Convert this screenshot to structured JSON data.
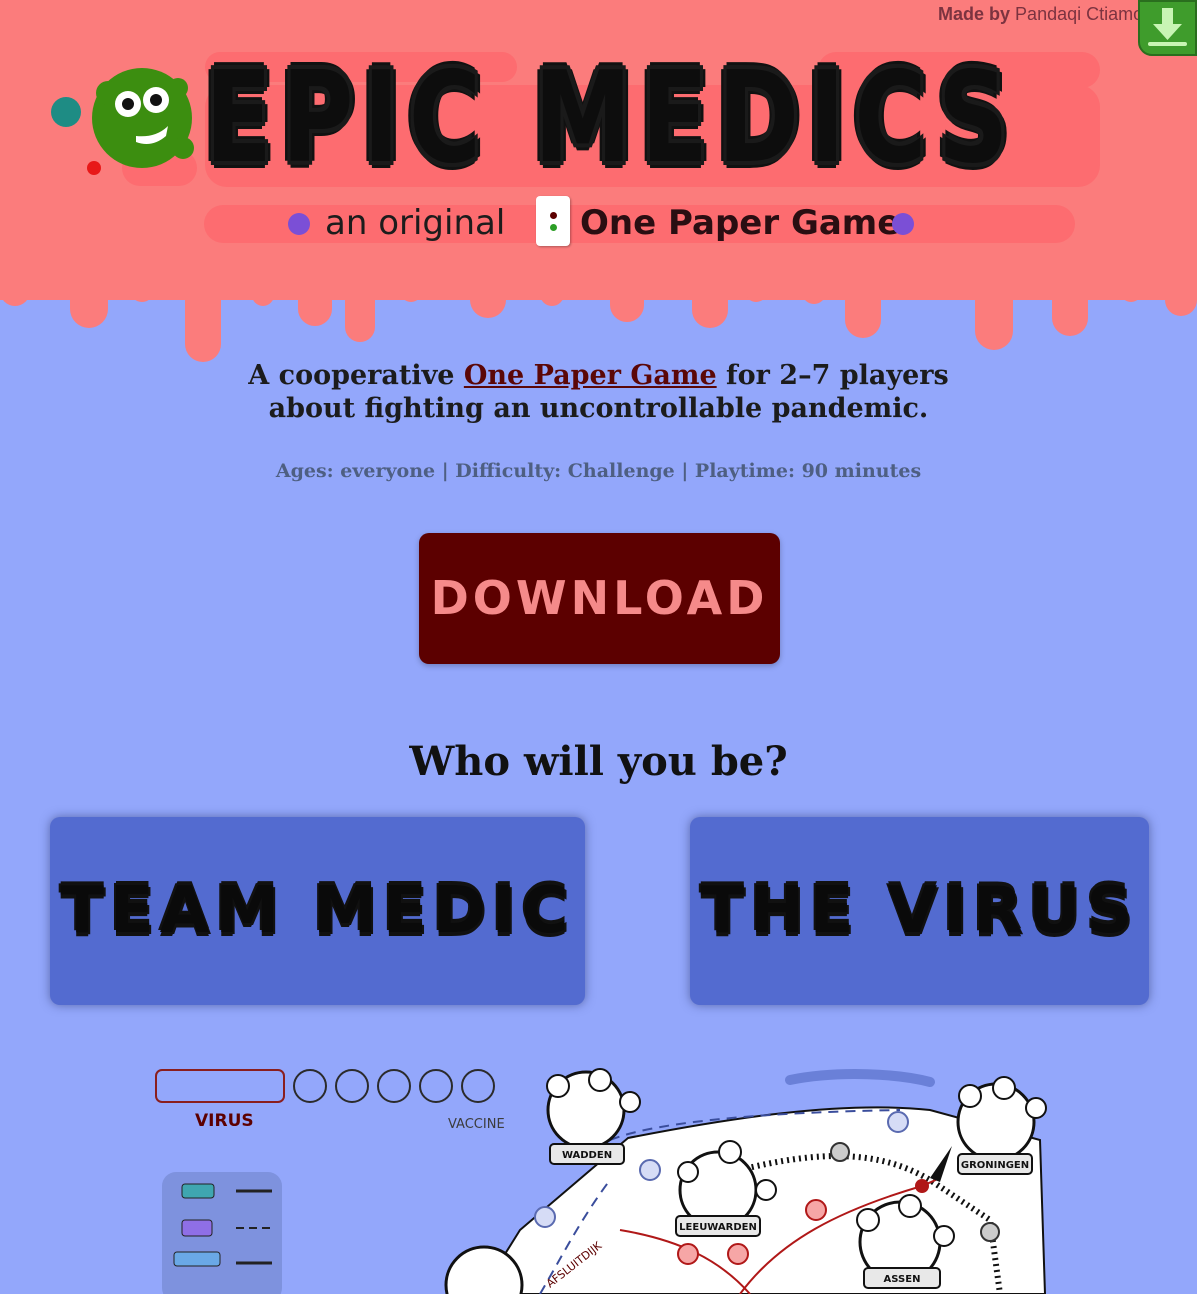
{
  "credit": {
    "made_by": "Made by",
    "studio": "Pandaqi Ctiamo P"
  },
  "header": {
    "title": "EPIC MEDICS",
    "subtitle_prefix": "an original",
    "subtitle_brand": "One Paper Game"
  },
  "intro": {
    "line1_before": "A cooperative ",
    "line1_link": "One Paper Game",
    "line1_after": " for 2–7 players",
    "line2": "about fighting an uncontrollable pandemic."
  },
  "meta": "Ages: everyone | Difficulty: Challenge | Playtime: 90 minutes",
  "download": {
    "label": "DOWNLOAD"
  },
  "roles": {
    "heading": "Who will you be?",
    "team_medic": "TEAM MEDIC",
    "the_virus": "THE VIRUS"
  },
  "board": {
    "virus_label": "VIRUS",
    "vaccine_label": "VACCINE",
    "cities": [
      "WADDEN",
      "GRONINGEN",
      "LEEUWARDEN",
      "ASSEN"
    ],
    "route_label": "AFSLUITDIJK"
  },
  "colors": {
    "header_bg": "#fb7c7c",
    "page_bg": "#93a7fb",
    "download_bg": "#5c0000",
    "download_text": "#f58a8a",
    "card_bg": "#536bd0",
    "link": "#5b0707",
    "mascot_green": "#3c8e10"
  }
}
